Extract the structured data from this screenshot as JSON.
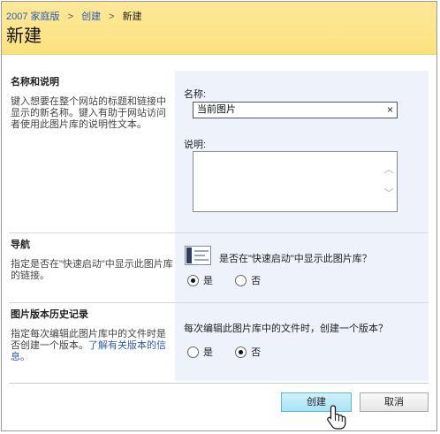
{
  "breadcrumb": {
    "site": "2007 家庭版",
    "create": "创建",
    "current": "新建",
    "separator": ">"
  },
  "page_title": "新建",
  "name_section": {
    "title": "名称和说明",
    "description": "键入想要在整个网站的标题和链接中显示的新名称。键入有助于网站访问者使用此图片库的说明性文本。",
    "name_label": "名称:",
    "name_value": "当前图片",
    "clear_icon": "×",
    "desc_label": "说明:",
    "desc_value": ""
  },
  "nav_section": {
    "title": "导航",
    "description": "指定是否在\"快速启动\"中显示此图片库的链接。",
    "question": "是否在\"快速启动\"中显示此图片库？",
    "options": [
      {
        "label": "是",
        "checked": true
      },
      {
        "label": "否",
        "checked": false
      }
    ]
  },
  "version_section": {
    "title": "图片版本历史记录",
    "description_prefix": "指定每次编辑此图片库中的文件时是否创建一个版本。",
    "description_link": "了解有关版本的信息。",
    "question": "每次编辑此图片库中的文件时，创建一个版本？",
    "options": [
      {
        "label": "是",
        "checked": false
      },
      {
        "label": "否",
        "checked": true
      }
    ]
  },
  "buttons": {
    "create": "创建",
    "cancel": "取消"
  },
  "colors": {
    "header_bg": "#fbe27f",
    "link": "#2a5db0",
    "panel_bg": "#eef3fb",
    "create_button": "#a9e2f6"
  }
}
